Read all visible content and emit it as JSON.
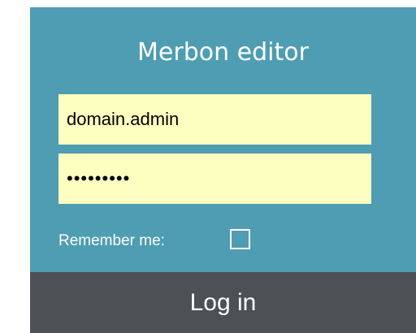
{
  "login": {
    "title": "Merbon editor",
    "username_value": "domain.admin",
    "password_value": "•••••••••",
    "remember_label": "Remember me:",
    "remember_checked": false,
    "submit_label": "Log in"
  },
  "colors": {
    "panel_background": "#4e9db2",
    "input_background": "#fdffc0",
    "button_background": "#4c5155",
    "text_light": "#ffffff"
  }
}
